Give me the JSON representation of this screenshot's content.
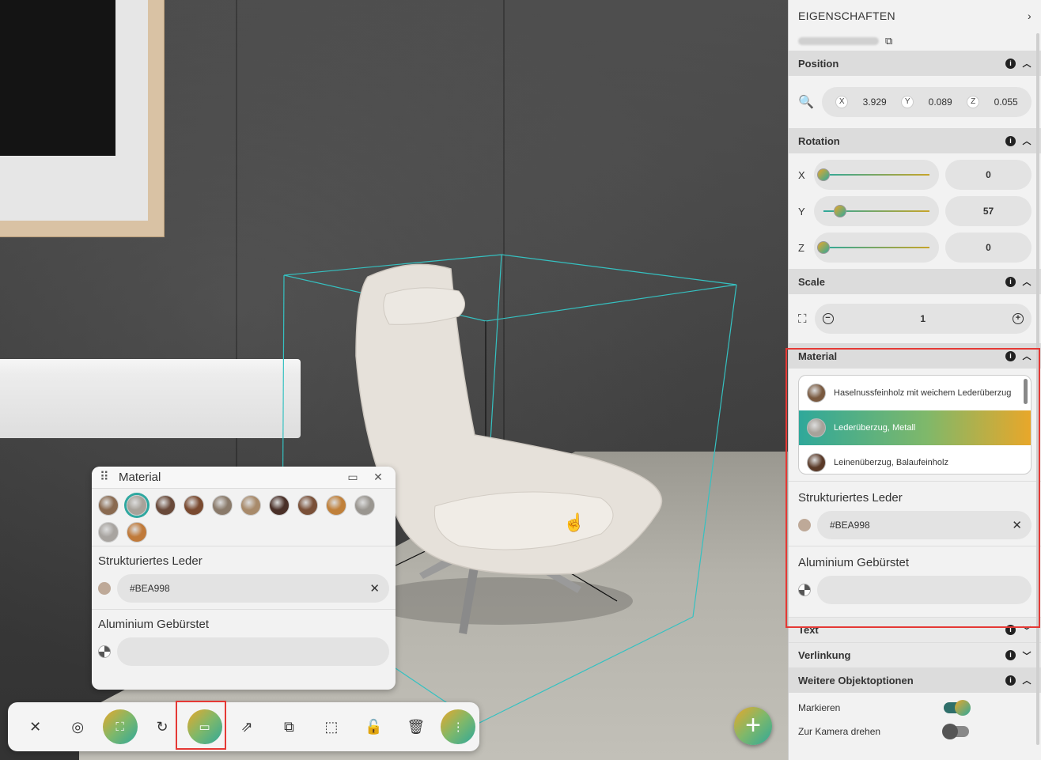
{
  "scene": {
    "material_panel": {
      "title": "Material",
      "swatches": [
        "#8a6a50",
        "#a8a29a",
        "#6a4a3a",
        "#7a4a30",
        "#8a7a6a",
        "#a88a6a",
        "#4a3028",
        "#7a5038",
        "#c0803a",
        "#9a9690",
        "#a8a4a0",
        "#c07a3a"
      ],
      "selected_swatch": 1,
      "leather_title": "Strukturiertes Leder",
      "leather_color": "#BEA998",
      "aluminium_title": "Aluminium Gebürstet",
      "aluminium_value": ""
    },
    "add_button_icon": "plus-icon"
  },
  "toolbar": {
    "buttons": [
      {
        "icon": "close-icon",
        "glyph": "✕"
      },
      {
        "icon": "view-icon",
        "glyph": "◎"
      },
      {
        "icon": "fullscreen-icon",
        "glyph": "⛶"
      },
      {
        "icon": "rotate-icon",
        "glyph": "↻"
      },
      {
        "icon": "material-icon",
        "glyph": "▭"
      },
      {
        "icon": "external-link-icon",
        "glyph": "⇗"
      },
      {
        "icon": "copy-icon",
        "glyph": "⧉"
      },
      {
        "icon": "select-area-icon",
        "glyph": "⬚"
      },
      {
        "icon": "unlock-icon",
        "glyph": "🔓"
      },
      {
        "icon": "trash-icon",
        "glyph": "🗑"
      },
      {
        "icon": "more-icon",
        "glyph": "⋮"
      }
    ]
  },
  "props": {
    "header": "EIGENSCHAFTEN",
    "position": {
      "title": "Position",
      "x_label": "X",
      "x": "3.929",
      "y_label": "Y",
      "y": "0.089",
      "z_label": "Z",
      "z": "0.055"
    },
    "rotation": {
      "title": "Rotation",
      "rows": [
        {
          "axis": "X",
          "value": "0",
          "fraction": 0.0
        },
        {
          "axis": "Y",
          "value": "57",
          "fraction": 0.158
        },
        {
          "axis": "Z",
          "value": "0",
          "fraction": 0.0
        }
      ]
    },
    "scale": {
      "title": "Scale",
      "value": "1"
    },
    "material": {
      "title": "Material",
      "items": [
        {
          "label": "Haselnussfeinholz mit weichem Lederüberzug",
          "color": "#7a5a40"
        },
        {
          "label": "Lederüberzug, Metall",
          "color": "#a8a29a",
          "selected": true
        },
        {
          "label": "Leinenüberzug, Balaufeinholz",
          "color": "#5a3a28"
        }
      ],
      "leather_title": "Strukturiertes Leder",
      "leather_color": "#BEA998",
      "aluminium_title": "Aluminium Gebürstet"
    },
    "text_title": "Text",
    "link_title": "Verlinkung",
    "options": {
      "title": "Weitere Objektoptionen",
      "mark_label": "Markieren",
      "mark_on": true,
      "camera_label": "Zur Kamera drehen",
      "camera_on": false
    }
  }
}
